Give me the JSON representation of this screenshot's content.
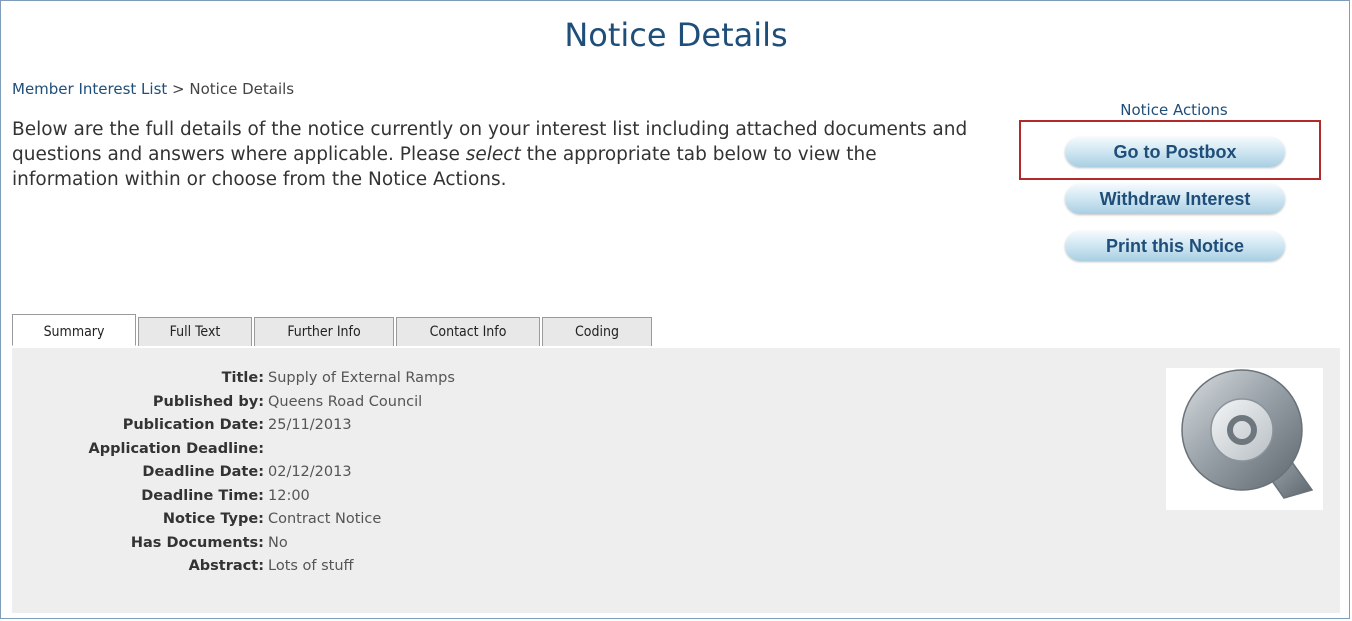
{
  "page": {
    "title": "Notice Details"
  },
  "breadcrumb": {
    "parent": "Member Interest List",
    "separator": ">",
    "current": "Notice Details"
  },
  "intro": {
    "before_select": "Below are the full details of the notice currently on your interest list including attached documents and questions and answers where applicable. Please ",
    "select_word": "select",
    "after_select": " the appropriate tab below to view the information within or choose from the Notice Actions."
  },
  "actions": {
    "label": "Notice Actions",
    "buttons": [
      "Go to Postbox",
      "Withdraw Interest",
      "Print this Notice"
    ],
    "highlighted": "Go to Postbox",
    "highlight_color": "#b02a2a"
  },
  "tabs": {
    "items": [
      "Summary",
      "Full Text",
      "Further Info",
      "Contact Info",
      "Coding"
    ],
    "active": "Summary"
  },
  "summary": {
    "fields": [
      {
        "label": "Title:",
        "value": "Supply of External Ramps"
      },
      {
        "label": "Published by:",
        "value": "Queens Road Council"
      },
      {
        "label": "Publication Date:",
        "value": "25/11/2013"
      },
      {
        "label": "Application Deadline:",
        "value": ""
      },
      {
        "label": "Deadline Date:",
        "value": "02/12/2013"
      },
      {
        "label": "Deadline Time:",
        "value": "12:00"
      },
      {
        "label": "Notice Type:",
        "value": "Contract Notice"
      },
      {
        "label": "Has Documents:",
        "value": "No"
      },
      {
        "label": "Abstract:",
        "value": "Lots of stuff"
      }
    ],
    "logo_icon": "q-logo-icon"
  },
  "colors": {
    "title": "#1f4e79",
    "panel_bg": "#eeeeee",
    "button_text": "#1f4e79"
  }
}
